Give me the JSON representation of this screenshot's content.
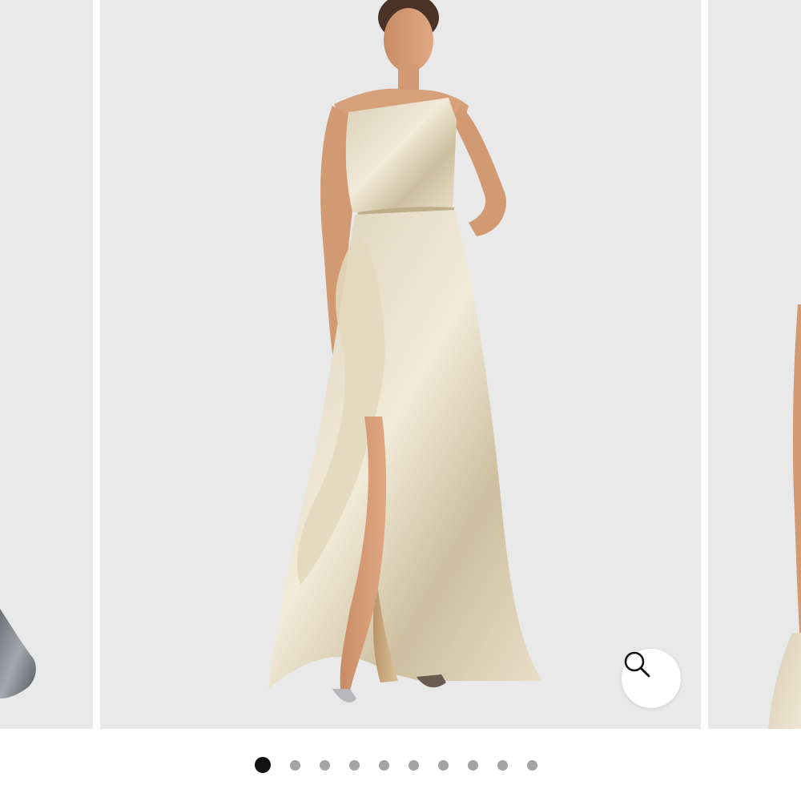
{
  "gallery": {
    "slides": [
      {
        "position": "previous",
        "description_icon": "silver-gown-hem"
      },
      {
        "position": "current",
        "description_icon": "gold-one-shoulder-gown"
      },
      {
        "position": "next",
        "description_icon": "gown-partial"
      }
    ],
    "background_color": "#e9e9e9",
    "zoom_icon": "magnifier-icon"
  },
  "pagination": {
    "total": 10,
    "active_index": 0,
    "active_color": "#111111",
    "inactive_color": "#a4a4a4"
  }
}
